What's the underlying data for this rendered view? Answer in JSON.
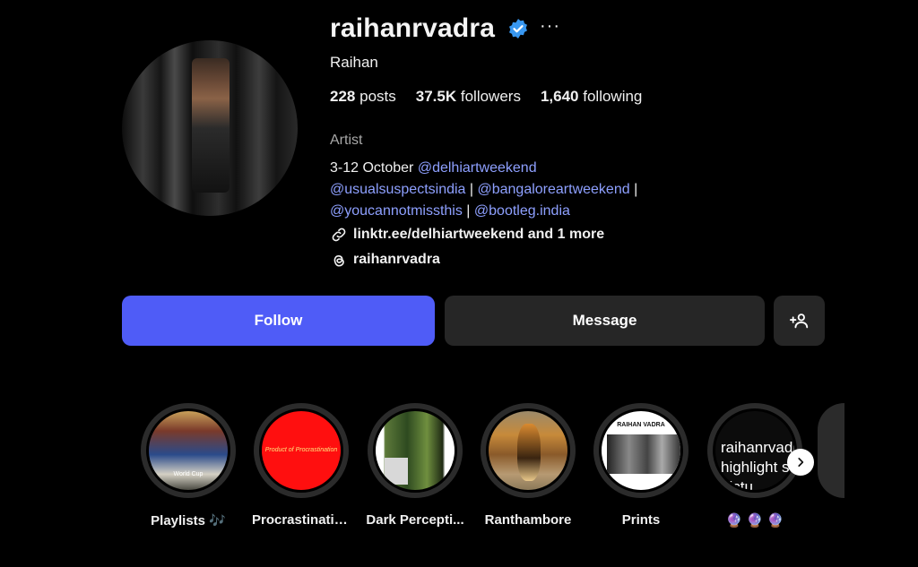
{
  "profile": {
    "username": "raihanrvadra",
    "full_name": "Raihan",
    "verified_icon": "verified-badge-icon",
    "more_label": "···",
    "stats": {
      "posts_count": "228",
      "posts_label": "posts",
      "followers_count": "37.5K",
      "followers_label": "followers",
      "following_count": "1,640",
      "following_label": "following"
    },
    "category": "Artist",
    "bio": {
      "line1_text": "3-12 October ",
      "line1_mention": "@delhiartweekend",
      "line2_mention1": "@usualsuspectsindia",
      "separator": " | ",
      "line2_mention2": "@bangaloreartweekend",
      "line2_tail": " |",
      "line3_mention1": "@youcannotmissthis",
      "line3_mention2": "@bootleg.india"
    },
    "link_text": "linktr.ee/delhiartweekend and 1 more",
    "threads_handle": "raihanrvadra"
  },
  "actions": {
    "follow_label": "Follow",
    "message_label": "Message"
  },
  "highlights": [
    {
      "label": "Playlists 🎶",
      "cover_text": "World Cup"
    },
    {
      "label": "Procrastination",
      "cover_text": "Product of Procrastination"
    },
    {
      "label": "Dark Percepti...",
      "cover_text": ""
    },
    {
      "label": "Ranthambore",
      "cover_text": ""
    },
    {
      "label": "Prints",
      "cover_text": "RAIHAN VADRA"
    },
    {
      "label": "🔮 🔮 🔮",
      "cover_text": "raihanrvadra highlight story pictu"
    }
  ],
  "colors": {
    "background": "#000000",
    "accent": "#4f5cf7",
    "mention": "#8ea0ff",
    "button_secondary": "#262626",
    "verified": "#3897f0"
  }
}
